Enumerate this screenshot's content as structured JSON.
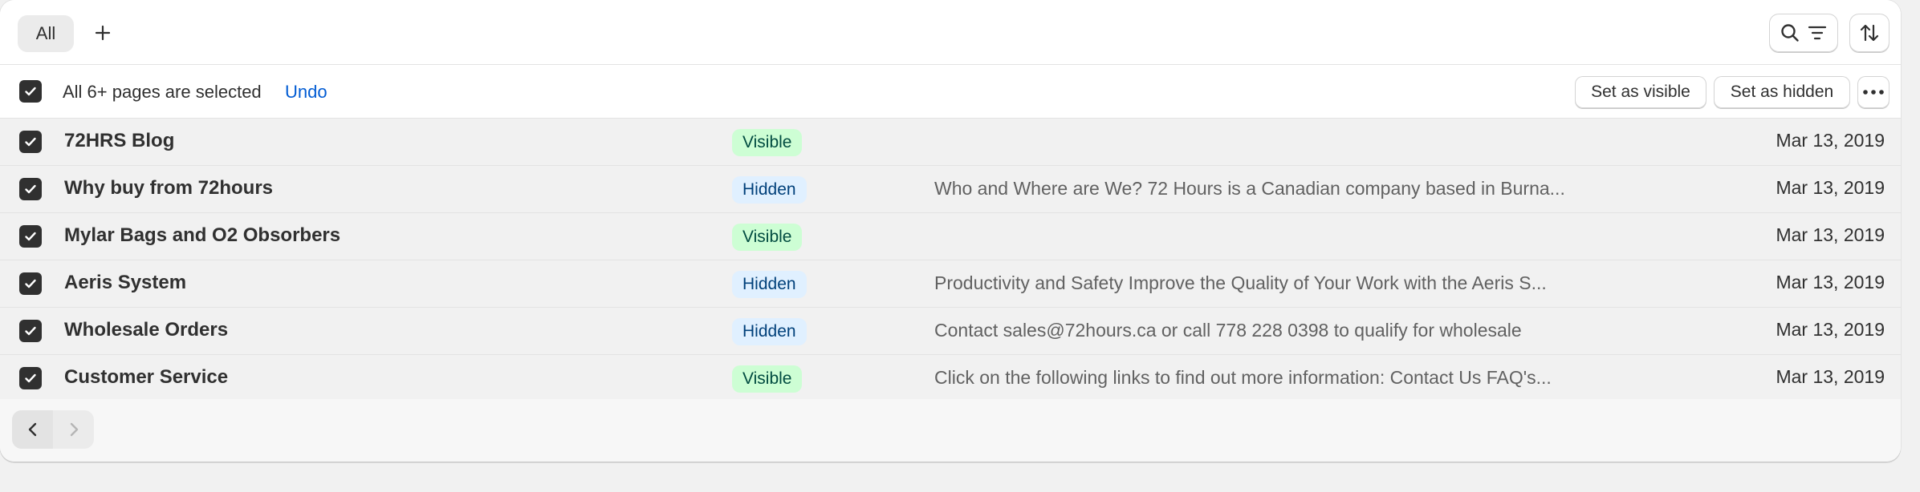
{
  "tabs": {
    "all_label": "All",
    "add_symbol": "+"
  },
  "toolbar": {
    "search_icon": "search-icon",
    "filter_icon": "filter-icon",
    "sort_icon": "sort-icon"
  },
  "bulk": {
    "selection_text": "All 6+ pages are selected",
    "undo_label": "Undo",
    "set_visible_label": "Set as visible",
    "set_hidden_label": "Set as hidden",
    "more_icon": "more-horizontal-icon"
  },
  "rows": [
    {
      "title": "72HRS Blog",
      "status": "Visible",
      "content": "",
      "date": "Mar 13, 2019"
    },
    {
      "title": "Why buy from 72hours",
      "status": "Hidden",
      "content": "Who and Where are We? 72 Hours is a Canadian company based in Burna...",
      "date": "Mar 13, 2019"
    },
    {
      "title": "Mylar Bags and O2 Obsorbers",
      "status": "Visible",
      "content": "",
      "date": "Mar 13, 2019"
    },
    {
      "title": "Aeris System",
      "status": "Hidden",
      "content": "Productivity and Safety Improve the Quality of Your Work with the Aeris S...",
      "date": "Mar 13, 2019"
    },
    {
      "title": "Wholesale Orders",
      "status": "Hidden",
      "content": "Contact sales@72hours.ca or call 778 228 0398 to qualify for wholesale",
      "date": "Mar 13, 2019"
    },
    {
      "title": "Customer Service",
      "status": "Visible",
      "content": "Click on the following links to find out more information: Contact Us FAQ's...",
      "date": "Mar 13, 2019"
    }
  ],
  "colors": {
    "visible_badge_bg": "#cdfed4",
    "hidden_badge_bg": "#e0f0ff",
    "link": "#005bd3",
    "checkbox": "#303030"
  }
}
